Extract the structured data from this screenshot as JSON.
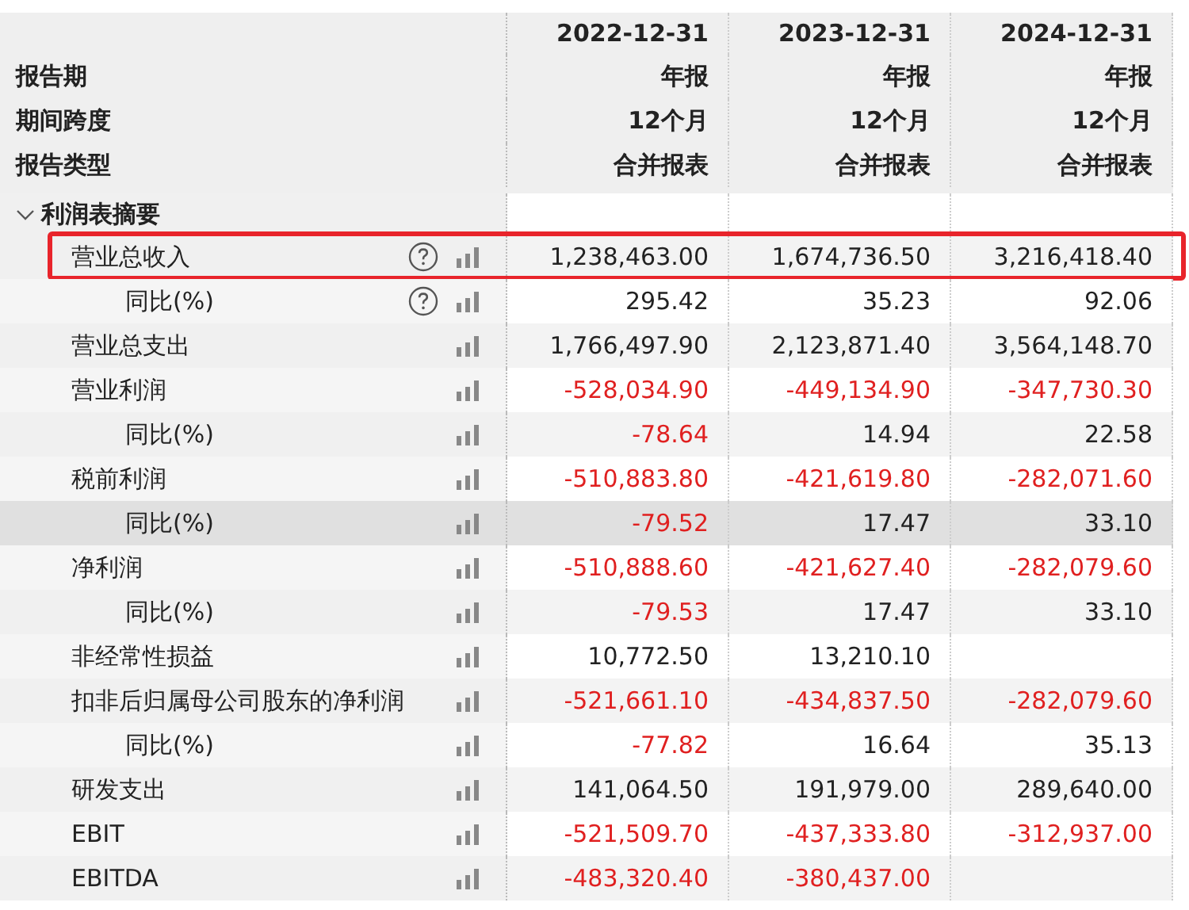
{
  "header": {
    "columns": [
      "2022-12-31",
      "2023-12-31",
      "2024-12-31"
    ],
    "rows": [
      {
        "label": "报告期",
        "values": [
          "年报",
          "年报",
          "年报"
        ]
      },
      {
        "label": "期间跨度",
        "values": [
          "12个月",
          "12个月",
          "12个月"
        ]
      },
      {
        "label": "报告类型",
        "values": [
          "合并报表",
          "合并报表",
          "合并报表"
        ]
      }
    ]
  },
  "section": {
    "label": "利润表摘要",
    "expanded": true,
    "rows": [
      {
        "label": "营业总收入",
        "help": true,
        "boxed": true,
        "highlighted": false,
        "cells": [
          {
            "text": "1,238,463.00",
            "negative": false
          },
          {
            "text": "1,674,736.50",
            "negative": false
          },
          {
            "text": "3,216,418.40",
            "negative": false
          }
        ],
        "children": [
          {
            "label": "同比(%)",
            "help": true,
            "boxed": false,
            "highlighted": false,
            "cells": [
              {
                "text": "295.42",
                "negative": false
              },
              {
                "text": "35.23",
                "negative": false
              },
              {
                "text": "92.06",
                "negative": false
              }
            ]
          }
        ]
      },
      {
        "label": "营业总支出",
        "help": false,
        "boxed": false,
        "highlighted": false,
        "cells": [
          {
            "text": "1,766,497.90",
            "negative": false
          },
          {
            "text": "2,123,871.40",
            "negative": false
          },
          {
            "text": "3,564,148.70",
            "negative": false
          }
        ]
      },
      {
        "label": "营业利润",
        "help": false,
        "boxed": false,
        "highlighted": false,
        "cells": [
          {
            "text": "-528,034.90",
            "negative": true
          },
          {
            "text": "-449,134.90",
            "negative": true
          },
          {
            "text": "-347,730.30",
            "negative": true
          }
        ],
        "children": [
          {
            "label": "同比(%)",
            "help": false,
            "boxed": false,
            "highlighted": false,
            "cells": [
              {
                "text": "-78.64",
                "negative": true
              },
              {
                "text": "14.94",
                "negative": false
              },
              {
                "text": "22.58",
                "negative": false
              }
            ]
          }
        ]
      },
      {
        "label": "税前利润",
        "help": false,
        "boxed": false,
        "highlighted": false,
        "cells": [
          {
            "text": "-510,883.80",
            "negative": true
          },
          {
            "text": "-421,619.80",
            "negative": true
          },
          {
            "text": "-282,071.60",
            "negative": true
          }
        ],
        "children": [
          {
            "label": "同比(%)",
            "help": false,
            "boxed": false,
            "highlighted": true,
            "cells": [
              {
                "text": "-79.52",
                "negative": true
              },
              {
                "text": "17.47",
                "negative": false
              },
              {
                "text": "33.10",
                "negative": false
              }
            ]
          }
        ]
      },
      {
        "label": "净利润",
        "help": false,
        "boxed": false,
        "highlighted": false,
        "cells": [
          {
            "text": "-510,888.60",
            "negative": true
          },
          {
            "text": "-421,627.40",
            "negative": true
          },
          {
            "text": "-282,079.60",
            "negative": true
          }
        ],
        "children": [
          {
            "label": "同比(%)",
            "help": false,
            "boxed": false,
            "highlighted": false,
            "cells": [
              {
                "text": "-79.53",
                "negative": true
              },
              {
                "text": "17.47",
                "negative": false
              },
              {
                "text": "33.10",
                "negative": false
              }
            ]
          }
        ]
      },
      {
        "label": "非经常性损益",
        "help": false,
        "boxed": false,
        "highlighted": false,
        "cells": [
          {
            "text": "10,772.50",
            "negative": false
          },
          {
            "text": "13,210.10",
            "negative": false
          },
          null
        ]
      },
      {
        "label": "扣非后归属母公司股东的净利润",
        "help": false,
        "boxed": false,
        "highlighted": false,
        "cells": [
          {
            "text": "-521,661.10",
            "negative": true
          },
          {
            "text": "-434,837.50",
            "negative": true
          },
          {
            "text": "-282,079.60",
            "negative": true
          }
        ],
        "children": [
          {
            "label": "同比(%)",
            "help": false,
            "boxed": false,
            "highlighted": false,
            "cells": [
              {
                "text": "-77.82",
                "negative": true
              },
              {
                "text": "16.64",
                "negative": false
              },
              {
                "text": "35.13",
                "negative": false
              }
            ]
          }
        ]
      },
      {
        "label": "研发支出",
        "help": false,
        "boxed": false,
        "highlighted": false,
        "cells": [
          {
            "text": "141,064.50",
            "negative": false
          },
          {
            "text": "191,979.00",
            "negative": false
          },
          {
            "text": "289,640.00",
            "negative": false
          }
        ]
      },
      {
        "label": "EBIT",
        "help": false,
        "boxed": false,
        "highlighted": false,
        "cells": [
          {
            "text": "-521,509.70",
            "negative": true
          },
          {
            "text": "-437,333.80",
            "negative": true
          },
          {
            "text": "-312,937.00",
            "negative": true
          }
        ]
      },
      {
        "label": "EBITDA",
        "help": false,
        "boxed": false,
        "highlighted": false,
        "cells": [
          {
            "text": "-483,320.40",
            "negative": true
          },
          {
            "text": "-380,437.00",
            "negative": true
          },
          null
        ]
      }
    ]
  }
}
